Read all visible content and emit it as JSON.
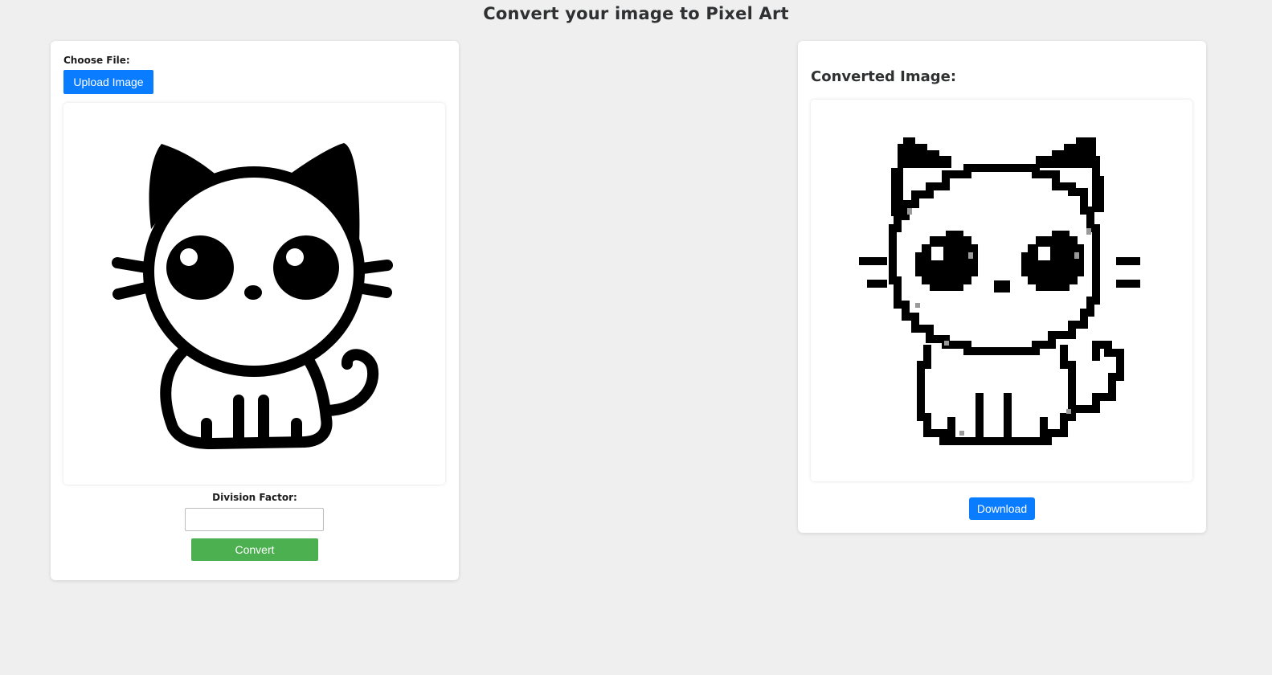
{
  "page": {
    "title": "Convert your image to Pixel Art"
  },
  "upload_panel": {
    "choose_file_label": "Choose File:",
    "upload_button_label": "Upload Image",
    "division_factor_label": "Division Factor:",
    "division_factor_value": "",
    "convert_button_label": "Convert"
  },
  "result_panel": {
    "heading": "Converted Image:",
    "download_button_label": "Download"
  },
  "colors": {
    "background": "#efefef",
    "upload_button": "#0a7cff",
    "convert_button": "#4caf50",
    "download_button": "#0a7cff",
    "ink": "#000000"
  }
}
